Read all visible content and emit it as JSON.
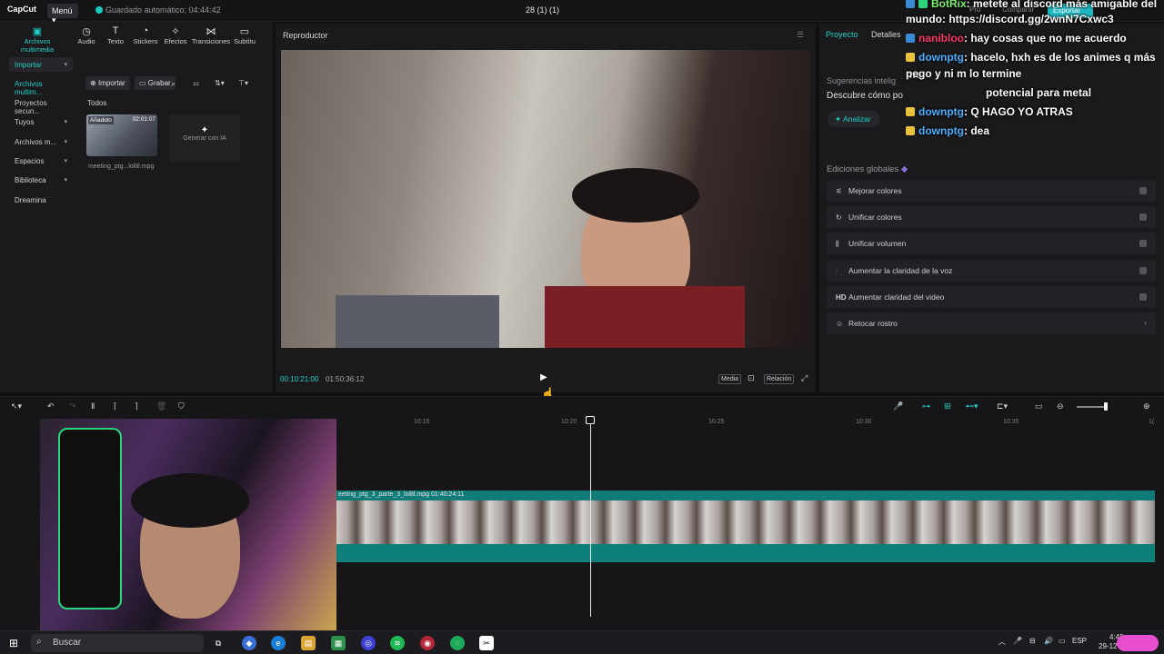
{
  "titlebar": {
    "logo": "CapCut",
    "menu": "Menú",
    "autosave": "Guardado automático: 04:44:42",
    "project_title": "28 (1) (1)",
    "pro": "Pro",
    "share": "Compartir",
    "export": "Exportar"
  },
  "media_tabs": [
    {
      "label": "Archivos multimedia",
      "icon": "media-icon"
    },
    {
      "label": "Audio",
      "icon": "audio-icon"
    },
    {
      "label": "Texto",
      "icon": "text-icon"
    },
    {
      "label": "Stickers",
      "icon": "sticker-icon"
    },
    {
      "label": "Efectos",
      "icon": "effects-icon"
    },
    {
      "label": "Transiciones",
      "icon": "transition-icon"
    },
    {
      "label": "Subtítu",
      "icon": "subtitle-icon"
    }
  ],
  "sidebar": {
    "importar": "Importar",
    "archivos": "Archivos multim...",
    "proyectos": "Proyectos secun...",
    "tuyos": "Tuyos",
    "archivos_m": "Archivos m...",
    "espacios": "Espacios",
    "biblioteca": "Biblioteca",
    "dreamina": "Dreamina"
  },
  "media": {
    "import_btn": "Importar",
    "record_btn": "Grabar",
    "todos": "Todos",
    "thumb_badge": "Añadido",
    "thumb_time": "02:01:07",
    "thumb_name": "meeting_ptg...lol8l.mpg",
    "gen_ia": "Generar con IA"
  },
  "player": {
    "title": "Reproductor",
    "time_current": "00:10:21:00",
    "time_total": "01:50:36:12",
    "media_btn": "Media",
    "ratio_btn": "Relación"
  },
  "right_panel": {
    "tab_project": "Proyecto",
    "tab_details": "Detalles",
    "suggestions_title": "Sugerencias intelig",
    "suggestions_desc": "Descubre cómo po",
    "analyze": "Analizar",
    "global_title": "Ediciones globales",
    "items": [
      {
        "label": "Mejorar colores",
        "icon": "wand-icon"
      },
      {
        "label": "Unificar colores",
        "icon": "palette-icon"
      },
      {
        "label": "Unificar volumen",
        "icon": "volume-icon"
      },
      {
        "label": "Aumentar la claridad de la voz",
        "icon": "voice-icon"
      },
      {
        "label": "Aumentar claridad del video",
        "icon": "hd-icon"
      },
      {
        "label": "Retocar rostro",
        "icon": "face-icon"
      }
    ]
  },
  "timeline": {
    "ruler": [
      "10:15",
      "10:20",
      "10:25",
      "10:30",
      "10:35",
      "1("
    ],
    "clip_label": "eeting_ptg_3_parte_3_lol8l.mpg  01:40:24:11"
  },
  "chat": [
    {
      "user": "BotRix",
      "text": ": metete al discord más amigable del",
      "user_color": "#7cf26a"
    },
    {
      "user": "",
      "text": "mundo: https://discord.gg/2wnN7Cxwc3",
      "user_color": "#ffffff"
    },
    {
      "user": "nanibloo",
      "text": ": hay cosas que no me acuerdo",
      "user_color": "#ff3a6a"
    },
    {
      "user": "downptg",
      "text": ": hacelo, hxh es de los animes q más me",
      "user_color": "#4ab0ff"
    },
    {
      "user": "",
      "text": "pego y ni m lo termine",
      "user_color": "#ffffff"
    },
    {
      "user": "",
      "text": "potencial para metal",
      "user_color": "#ffffff"
    },
    {
      "user": "downptg",
      "text": ": Q HAGO YO ATRAS",
      "user_color": "#4ab0ff"
    },
    {
      "user": "downptg",
      "text": ": dea",
      "user_color": "#4ab0ff"
    }
  ],
  "taskbar": {
    "search": "Buscar",
    "lang": "ESP",
    "time": "4:45",
    "date": "29-12-2"
  }
}
